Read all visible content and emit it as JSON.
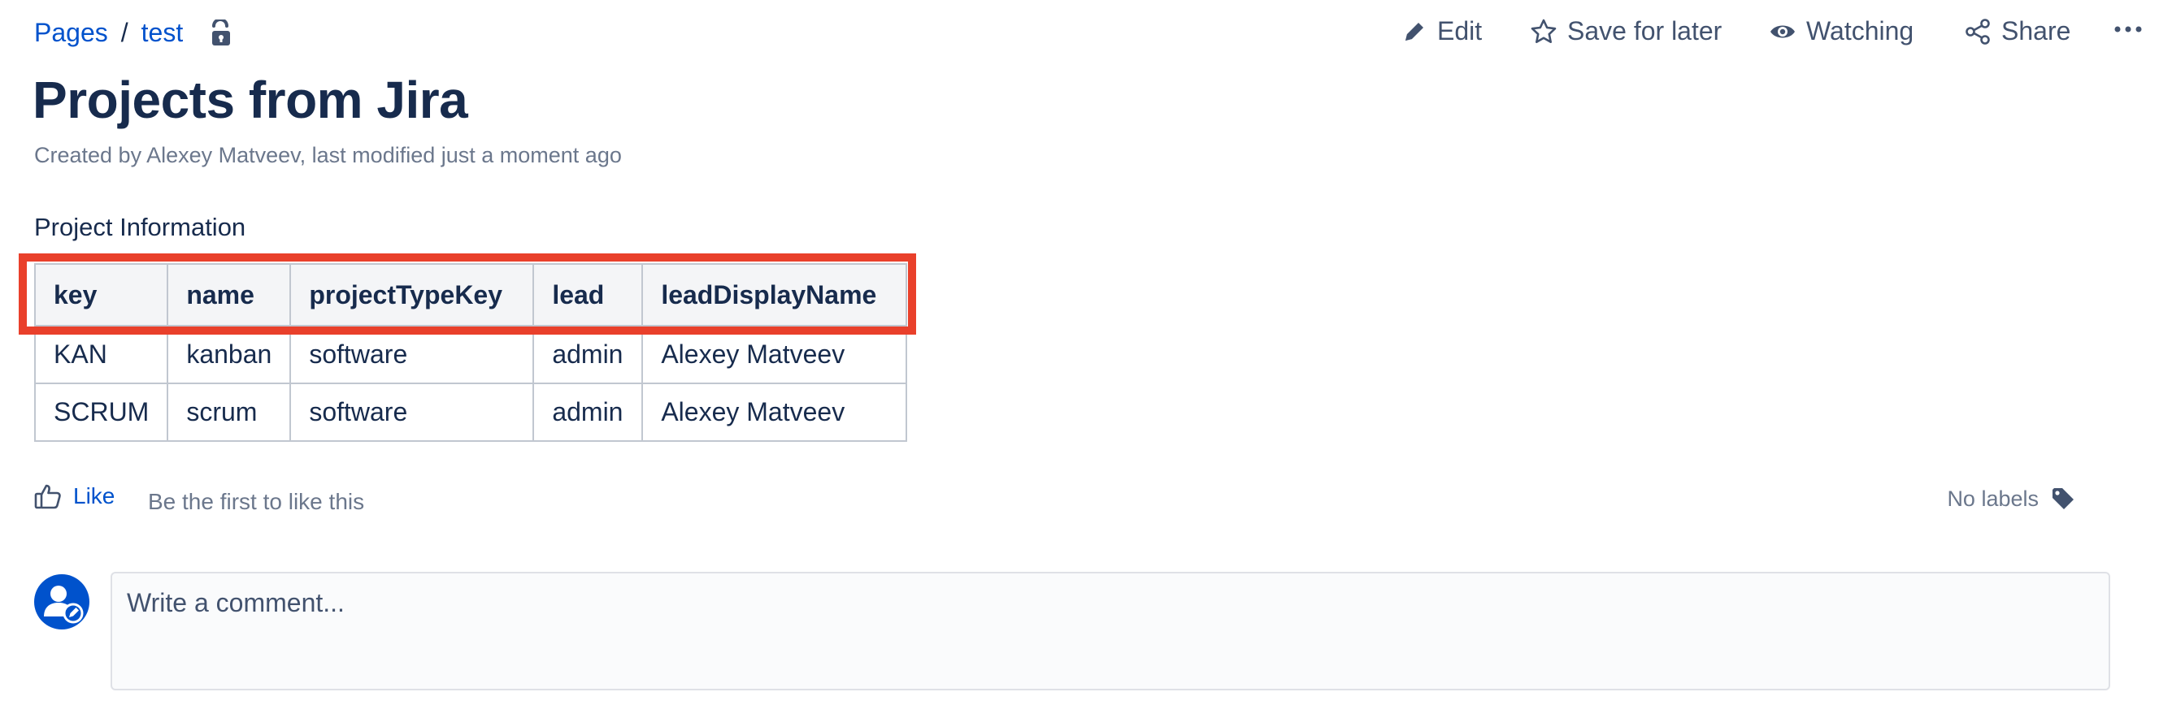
{
  "breadcrumb": {
    "items": [
      "Pages",
      "test"
    ],
    "separator": "/"
  },
  "actions": {
    "edit": "Edit",
    "save_for_later": "Save for later",
    "watching": "Watching",
    "share": "Share"
  },
  "page": {
    "title": "Projects from Jira",
    "byline": "Created by Alexey Matveev, last modified just a moment ago",
    "section_heading": "Project Information"
  },
  "table": {
    "headers": [
      "key",
      "name",
      "projectTypeKey",
      "lead",
      "leadDisplayName"
    ],
    "rows": [
      [
        "KAN",
        "kanban",
        "software",
        "admin",
        "Alexey Matveev"
      ],
      [
        "SCRUM",
        "scrum",
        "software",
        "admin",
        "Alexey Matveev"
      ]
    ]
  },
  "likes": {
    "like_label": "Like",
    "text": "Be the first to like this"
  },
  "labels": {
    "text": "No labels"
  },
  "comment": {
    "placeholder": "Write a comment..."
  },
  "colors": {
    "link": "#0052cc",
    "text": "#172b4d",
    "muted": "#6b778c",
    "highlight": "#e9402b",
    "header_bg": "#f4f5f7"
  },
  "icons": {
    "lock": "unlock-icon",
    "edit": "pencil-icon",
    "save": "star-icon",
    "watch": "eye-icon",
    "share": "share-icon",
    "more": "more-icon",
    "like": "thumbs-up-icon",
    "labels": "tag-icon",
    "avatar": "user-avatar-icon"
  }
}
